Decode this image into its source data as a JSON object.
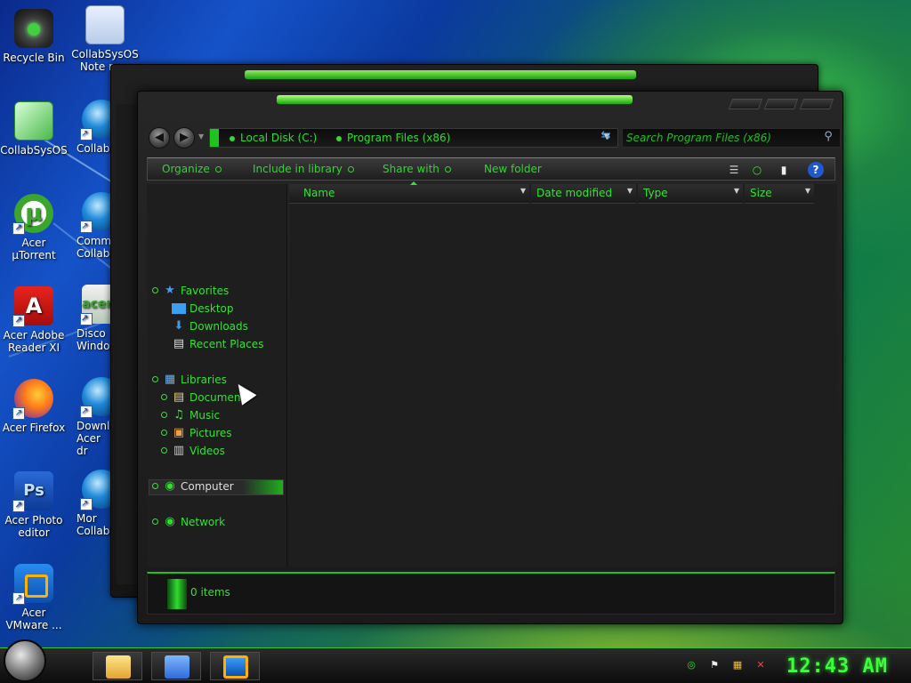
{
  "desktop": {
    "icons": [
      {
        "label": "Recycle Bin",
        "icon": "recycle-bin-icon"
      },
      {
        "label": "CollabSysOS Note re…",
        "icon": "notepad-icon"
      },
      {
        "label": "CollabSysOS",
        "icon": "collabsysos-icon"
      },
      {
        "label": "CollabS",
        "icon": "globe-icon"
      },
      {
        "label": "Acer µTorrent",
        "icon": "utorrent-icon"
      },
      {
        "label": "Comm CollabS",
        "icon": "globe-icon"
      },
      {
        "label": "Acer Adobe Reader XI",
        "icon": "adobe-reader-icon"
      },
      {
        "label": "Disco Windo",
        "icon": "acer-icon"
      },
      {
        "label": "Acer Firefox",
        "icon": "firefox-icon"
      },
      {
        "label": "Downl Acer dr",
        "icon": "globe-icon"
      },
      {
        "label": "Acer Photo editor",
        "icon": "photoshop-icon"
      },
      {
        "label": "Mor CollabS",
        "icon": "globe-icon"
      },
      {
        "label": "Acer VMware ...",
        "icon": "vmware-icon"
      }
    ]
  },
  "explorer": {
    "address": {
      "crumbs": [
        "Local Disk (C:)",
        "Program Files (x86)"
      ]
    },
    "search": {
      "placeholder": "Search Program Files (x86)"
    },
    "commands": [
      "Organize",
      "Include in library",
      "Share with",
      "New folder"
    ],
    "nav": {
      "favorites": {
        "label": "Favorites",
        "items": [
          "Desktop",
          "Downloads",
          "Recent Places"
        ]
      },
      "libraries": {
        "label": "Libraries",
        "items": [
          "Documents",
          "Music",
          "Pictures",
          "Videos"
        ]
      },
      "computer": "Computer",
      "network": "Network"
    },
    "columns": [
      "Name",
      "Date modified",
      "Type",
      "Size"
    ],
    "status": "0 items"
  },
  "taskbar": {
    "clock": "12:43 AM",
    "pinned": [
      "file-explorer-icon",
      "control-panel-icon",
      "vmware-icon"
    ]
  },
  "colors": {
    "accent": "#36e036",
    "window_bg": "#1e1e1e"
  }
}
